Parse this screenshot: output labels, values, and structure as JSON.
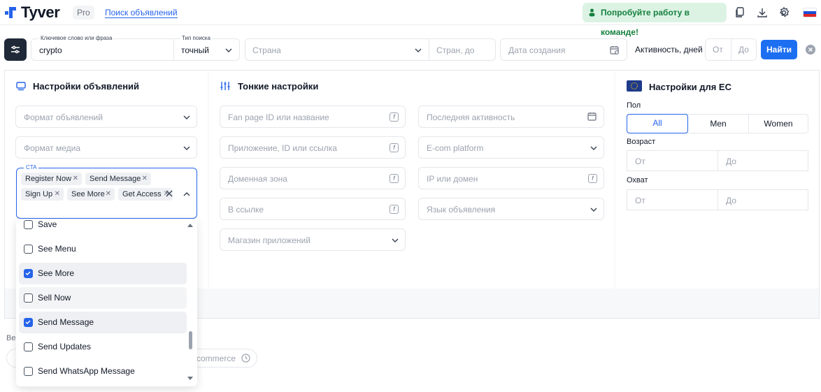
{
  "header": {
    "brand": "Tyver",
    "plan_badge": "Pro",
    "nav_link": "Поиск объявлений",
    "team_button": "Попробуйте работу в команде!",
    "icons": [
      "copy-icon",
      "download-icon",
      "settings-icon",
      "flag-ru-icon"
    ]
  },
  "search": {
    "keyword_label": "Ключевое слово или фраза",
    "keyword_value": "crypto",
    "type_label": "Тип поиска",
    "type_value": "точный",
    "country_placeholder": "Страна",
    "countries_to_placeholder": "Стран, до",
    "created_placeholder": "Дата создания",
    "activity_label": "Активность, дней",
    "activity_from": "От",
    "activity_to": "До",
    "search_button": "Найти"
  },
  "ad_settings": {
    "title": "Настройки объявлений",
    "format_placeholder": "Формат объявлений",
    "media_placeholder": "Формат медиа",
    "cta_label": "CTA",
    "cta_tags": [
      "Register Now",
      "Send Message",
      "Sign Up",
      "See More",
      "Get Access"
    ],
    "cta_options": [
      {
        "label": "Save",
        "checked": false
      },
      {
        "label": "See Menu",
        "checked": false
      },
      {
        "label": "See More",
        "checked": true
      },
      {
        "label": "Sell Now",
        "checked": false
      },
      {
        "label": "Send Message",
        "checked": true
      },
      {
        "label": "Send Updates",
        "checked": false
      },
      {
        "label": "Send WhatsApp Message",
        "checked": false
      }
    ]
  },
  "fine_settings": {
    "title": "Тонкие настройки",
    "fan_page": "Fan page ID или название",
    "app": "Приложение, ID или ссылка",
    "domain_zone": "Доменная зона",
    "in_link": "В ссылке",
    "app_store": "Магазин приложений",
    "last_activity": "Последняя активность",
    "ecom": "E-com platform",
    "ip_domain": "IP или домен",
    "ad_language": "Язык объявления"
  },
  "eu_settings": {
    "title": "Настройки для ЕС",
    "gender_label": "Пол",
    "gender_options": [
      "All",
      "Men",
      "Women"
    ],
    "gender_selected": "All",
    "age_label": "Возраст",
    "age_from": "От",
    "age_to": "До",
    "reach_label": "Охват",
    "reach_from": "От",
    "reach_to": "До"
  },
  "background": {
    "partial_label": "Ве",
    "partial_chip": "commerce"
  },
  "colors": {
    "accent": "#2563eb",
    "brand_button": "#1d6ff2",
    "team_button_bg": "#dcf3e4",
    "team_button_text": "#15803d"
  }
}
